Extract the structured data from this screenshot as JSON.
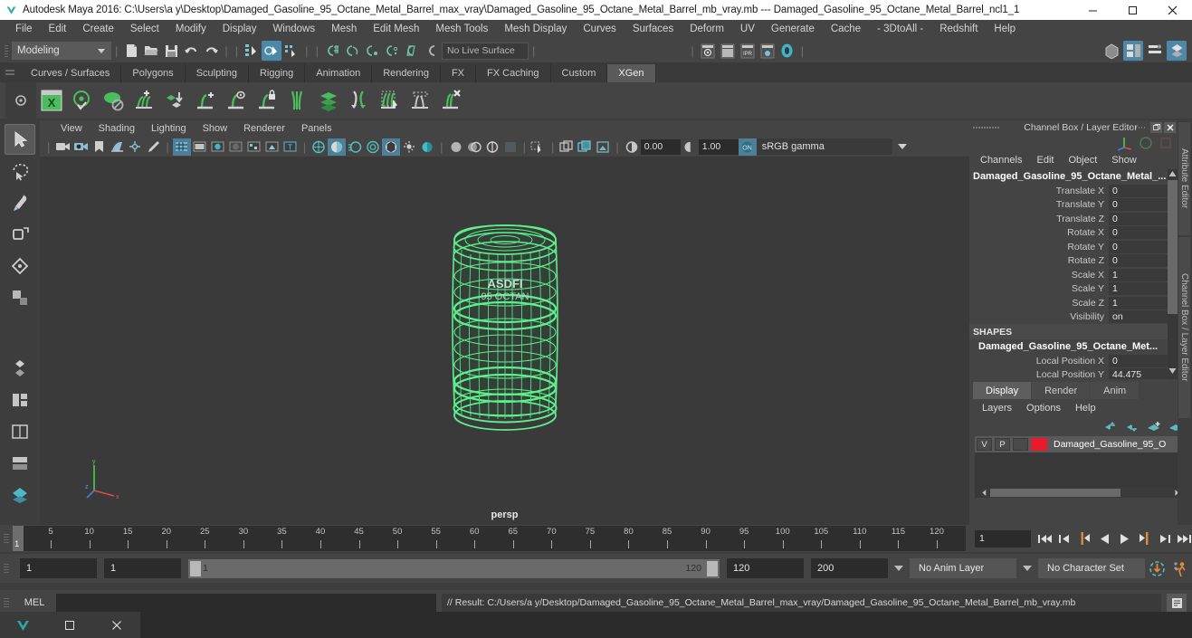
{
  "window": {
    "title": "Autodesk Maya 2016: C:\\Users\\a y\\Desktop\\Damaged_Gasoline_95_Octane_Metal_Barrel_max_vray\\Damaged_Gasoline_95_Octane_Metal_Barrel_mb_vray.mb  ---  Damaged_Gasoline_95_Octane_Metal_Barrel_ncl1_1",
    "minimize": "minimize-button",
    "maximize": "maximize-button",
    "close": "close-button"
  },
  "menubar": {
    "items": [
      "File",
      "Edit",
      "Create",
      "Select",
      "Modify",
      "Display",
      "Windows",
      "Mesh",
      "Edit Mesh",
      "Mesh Tools",
      "Mesh Display",
      "Curves",
      "Surfaces",
      "Deform",
      "UV",
      "Generate",
      "Cache",
      "- 3DtoAll -",
      "Redshift",
      "Help"
    ]
  },
  "statusline": {
    "mode": "Modeling",
    "live_surface": "No Live Surface"
  },
  "shelf": {
    "tabs": [
      "Curves / Surfaces",
      "Polygons",
      "Sculpting",
      "Rigging",
      "Animation",
      "Rendering",
      "FX",
      "FX Caching",
      "Custom",
      "XGen"
    ],
    "active_tab": "XGen",
    "icons": [
      "xgen-editor-icon",
      "xgen-preview-icon",
      "xgen-guide-visibility-icon",
      "xgen-add-description-icon",
      "xgen-place-icon",
      "xgen-add-guide-icon",
      "xgen-guide-preview-icon",
      "xgen-lock-guide-icon",
      "xgen-sculpt-guide-icon",
      "xgen-layers-icon",
      "xgen-groom-icon",
      "xgen-select-guides-icon",
      "xgen-bake-icon",
      "xgen-delete-guide-icon"
    ]
  },
  "viewport": {
    "menu": [
      "View",
      "Shading",
      "Lighting",
      "Show",
      "Renderer",
      "Panels"
    ],
    "exposure": "0.00",
    "gamma_value": "1.00",
    "color_profile": "sRGB gamma",
    "camera_label": "persp"
  },
  "channelbox": {
    "panel_title": "Channel Box / Layer Editor",
    "menu": [
      "Channels",
      "Edit",
      "Object",
      "Show"
    ],
    "object_name": "Damaged_Gasoline_95_Octane_Metal_...",
    "transform_attrs": [
      {
        "label": "Translate X",
        "value": "0"
      },
      {
        "label": "Translate Y",
        "value": "0"
      },
      {
        "label": "Translate Z",
        "value": "0"
      },
      {
        "label": "Rotate X",
        "value": "0"
      },
      {
        "label": "Rotate Y",
        "value": "0"
      },
      {
        "label": "Rotate Z",
        "value": "0"
      },
      {
        "label": "Scale X",
        "value": "1"
      },
      {
        "label": "Scale Y",
        "value": "1"
      },
      {
        "label": "Scale Z",
        "value": "1"
      },
      {
        "label": "Visibility",
        "value": "on"
      }
    ],
    "shapes_header": "SHAPES",
    "shape_name": "Damaged_Gasoline_95_Octane_Met...",
    "shape_attrs": [
      {
        "label": "Local Position X",
        "value": "0"
      },
      {
        "label": "Local Position Y",
        "value": "44.475"
      }
    ],
    "side_tabs": [
      "Attribute Editor",
      "Channel Box / Layer Editor"
    ]
  },
  "layereditor": {
    "tabs": [
      "Display",
      "Render",
      "Anim"
    ],
    "active_tab": "Display",
    "menu": [
      "Layers",
      "Options",
      "Help"
    ],
    "toolbar_icons": [
      "move-layer-up-icon",
      "move-layer-down-icon",
      "new-layer-from-selected-icon",
      "new-layer-icon"
    ],
    "layers": [
      {
        "visibility": "V",
        "playback": "P",
        "type": "",
        "color": "#e8192c",
        "name": "Damaged_Gasoline_95_O"
      }
    ]
  },
  "timeline": {
    "ticks": [
      5,
      10,
      15,
      20,
      25,
      30,
      35,
      40,
      45,
      50,
      55,
      60,
      65,
      70,
      75,
      80,
      85,
      90,
      95,
      100,
      105,
      110,
      115,
      120
    ],
    "current_frame": "1",
    "frame_field": "1",
    "playback_buttons": [
      "go-to-start-icon",
      "step-back-keyframe-icon",
      "step-back-frame-icon",
      "play-backwards-icon",
      "play-forwards-icon",
      "step-forward-frame-icon",
      "step-forward-keyframe-icon",
      "go-to-end-icon"
    ]
  },
  "rangeslider": {
    "anim_start": "1",
    "playback_start": "1",
    "range_start_label": "1",
    "range_end_label": "120",
    "playback_end": "120",
    "anim_end": "200",
    "anim_layer": "No Anim Layer",
    "character_set": "No Character Set",
    "auto_key_icon": "auto-keyframe-icon",
    "anim_prefs_icon": "animation-preferences-icon"
  },
  "commandline": {
    "mel_label": "MEL",
    "input_value": "",
    "result": "// Result: C:/Users/a y/Desktop/Damaged_Gasoline_95_Octane_Metal_Barrel_max_vray/Damaged_Gasoline_95_Octane_Metal_Barrel_mb_vray.mb",
    "help_icon": "script-editor-icon"
  },
  "taskbar": {
    "buttons": [
      "maya-app-icon",
      "restore-window-icon",
      "close-window-icon"
    ]
  },
  "colors": {
    "accent": "#4e88a8",
    "wireframe": "#5cf08a",
    "layer_swatch": "#e8192c",
    "panel_bg": "#444444",
    "viewport_bg": "#3a3a3a"
  }
}
